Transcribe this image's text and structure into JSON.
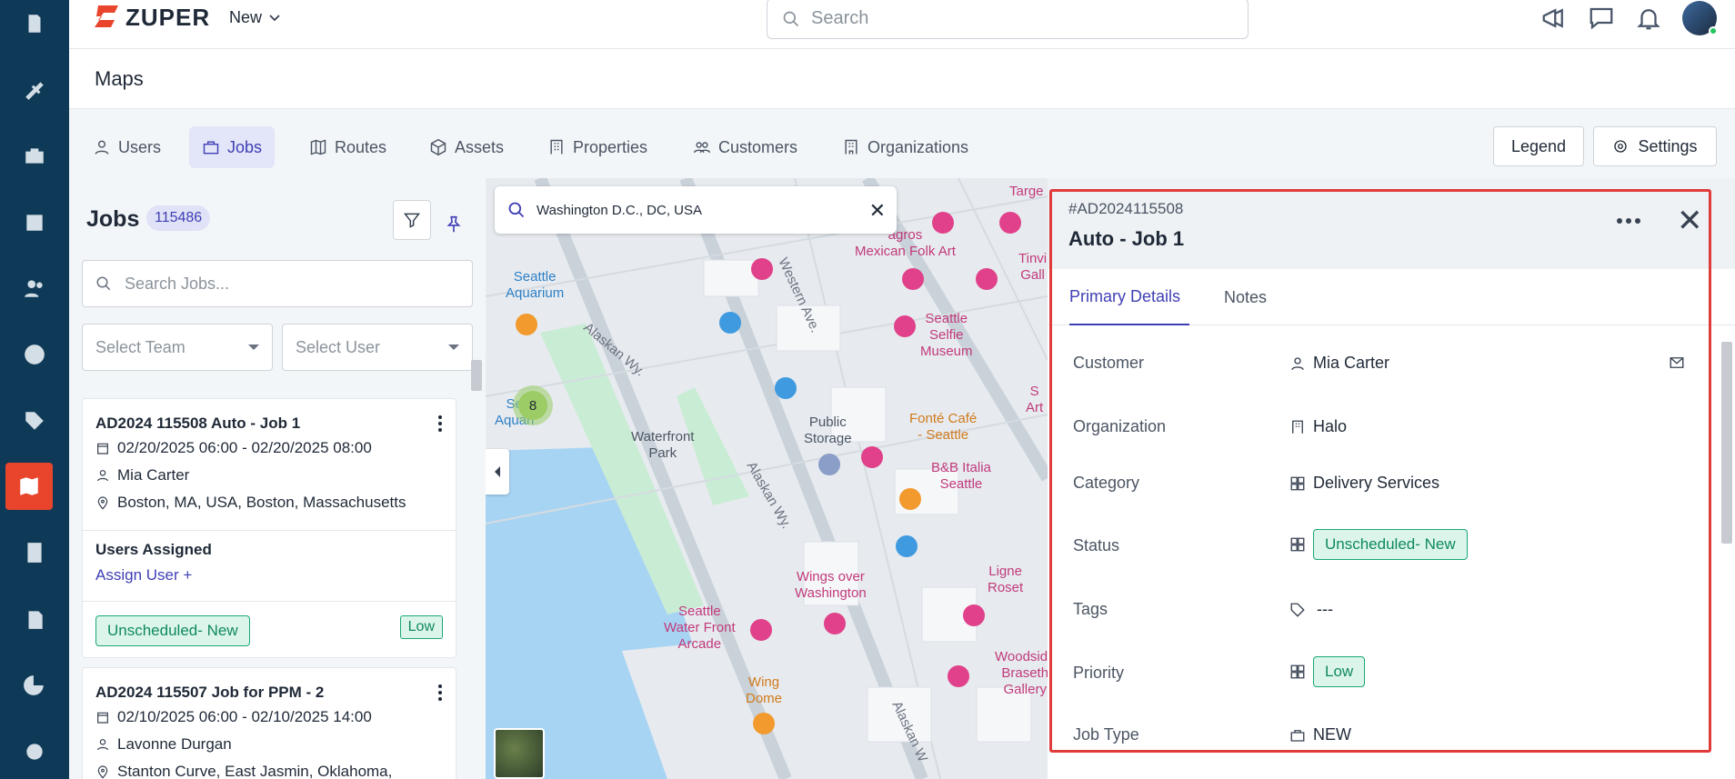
{
  "app": {
    "logo_text": "ZUPER",
    "new_label": "New",
    "search_placeholder": "Search"
  },
  "page": {
    "title": "Maps"
  },
  "tabs": [
    {
      "label": "Users",
      "icon": "user-icon"
    },
    {
      "label": "Jobs",
      "icon": "briefcase-icon",
      "active": true
    },
    {
      "label": "Routes",
      "icon": "map-icon"
    },
    {
      "label": "Assets",
      "icon": "cube-icon"
    },
    {
      "label": "Properties",
      "icon": "building-icon"
    },
    {
      "label": "Customers",
      "icon": "users-icon"
    },
    {
      "label": "Organizations",
      "icon": "office-icon"
    }
  ],
  "header_buttons": {
    "legend": "Legend",
    "settings": "Settings"
  },
  "jobs_panel": {
    "title": "Jobs",
    "count": "115486",
    "search_placeholder": "Search Jobs...",
    "team_placeholder": "Select Team",
    "user_placeholder": "Select User",
    "cards": [
      {
        "title": "AD2024 115508 Auto - Job 1",
        "schedule": "02/20/2025 06:00 - 02/20/2025 08:00",
        "customer": "Mia Carter",
        "address": "Boston, MA, USA, Boston, Massachusetts",
        "users_assigned_label": "Users Assigned",
        "assign_label": "Assign User +",
        "status": "Unscheduled- New",
        "priority": "Low"
      },
      {
        "title": "AD2024 115507 Job for PPM - 2",
        "schedule": "02/10/2025 06:00 - 02/10/2025 14:00",
        "customer": "Lavonne Durgan",
        "address": "Stanton Curve, East Jasmin, Oklahoma,"
      }
    ]
  },
  "map": {
    "search_value": "Washington D.C., DC, USA",
    "cluster_count": "8",
    "labels": {
      "seattle_aquarium": "Seattle\nAquarium",
      "sea_aquarium": "Se\nAquari",
      "alaskan_wy": "Alaskan Wy.",
      "alaskan_wy2": "Alaskan Wy.",
      "alaskan_w3": "Alaskan W",
      "western_ave": "Western Ave.",
      "waterfront_park": "Waterfront\nPark",
      "public_storage": "Public\nStorage",
      "seattle_selfie": "Seattle\nSelfie\nMuseum",
      "fonte_cafe": "Fonté Café\n- Seattle",
      "bb_italia": "B&B Italia\nSeattle",
      "agros": "agros\nMexican Folk Art",
      "target": "Targe",
      "tinvi": "Tinvi\nGall",
      "art": "S\nArt",
      "wings": "Wings over\nWashington",
      "ligne_roset": "Ligne\nRoset",
      "front_arcade": "Seattle\nWater Front\nArcade",
      "wing_dome": "Wing\nDome",
      "woodside": "Woodside\nBraseth\nGallery"
    }
  },
  "details": {
    "job_number": "#AD2024115508",
    "title": "Auto - Job 1",
    "tabs": [
      "Primary Details",
      "Notes"
    ],
    "rows": {
      "customer": {
        "label": "Customer",
        "value": "Mia Carter"
      },
      "organization": {
        "label": "Organization",
        "value": "Halo"
      },
      "category": {
        "label": "Category",
        "value": "Delivery Services"
      },
      "status": {
        "label": "Status",
        "value": "Unscheduled- New"
      },
      "tags": {
        "label": "Tags",
        "value": "---"
      },
      "priority": {
        "label": "Priority",
        "value": "Low"
      },
      "job_type": {
        "label": "Job Type",
        "value": "NEW"
      }
    }
  },
  "colors": {
    "rail": "#0f3a57",
    "accent": "#3f3fb5",
    "active_rail": "#e8452c",
    "status_green": "#0f8a5c",
    "highlight": "#e03b3b"
  }
}
